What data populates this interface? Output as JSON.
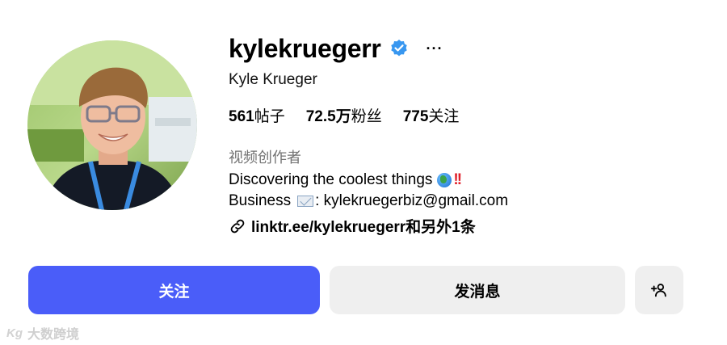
{
  "profile": {
    "username": "kylekruegerr",
    "full_name": "Kyle Krueger",
    "verified_icon": "verified-badge-icon",
    "more_icon": "more-options-icon",
    "more_glyph": "···",
    "stats": {
      "posts_count": "561",
      "posts_label": "帖子",
      "followers_count": "72.5万",
      "followers_label": "粉丝",
      "following_count": "775",
      "following_label": "关注"
    },
    "category": "视频创作者",
    "bio_line1": "Discovering the coolest things",
    "bio_line1_emoji": "!!",
    "bio_line2_prefix": "Business",
    "bio_line2_suffix": ": kylekruegerbiz@gmail.com",
    "link_text": "linktr.ee/kylekruegerr和另外1条"
  },
  "actions": {
    "follow_label": "关注",
    "message_label": "发消息",
    "suggest_icon": "add-person-icon"
  },
  "watermark": {
    "logo": "Kg",
    "text": "大数跨境"
  },
  "colors": {
    "follow_button": "#4a5df9",
    "secondary_button": "#efefef",
    "verified_blue": "#3897f0",
    "muted_text": "#737373"
  }
}
